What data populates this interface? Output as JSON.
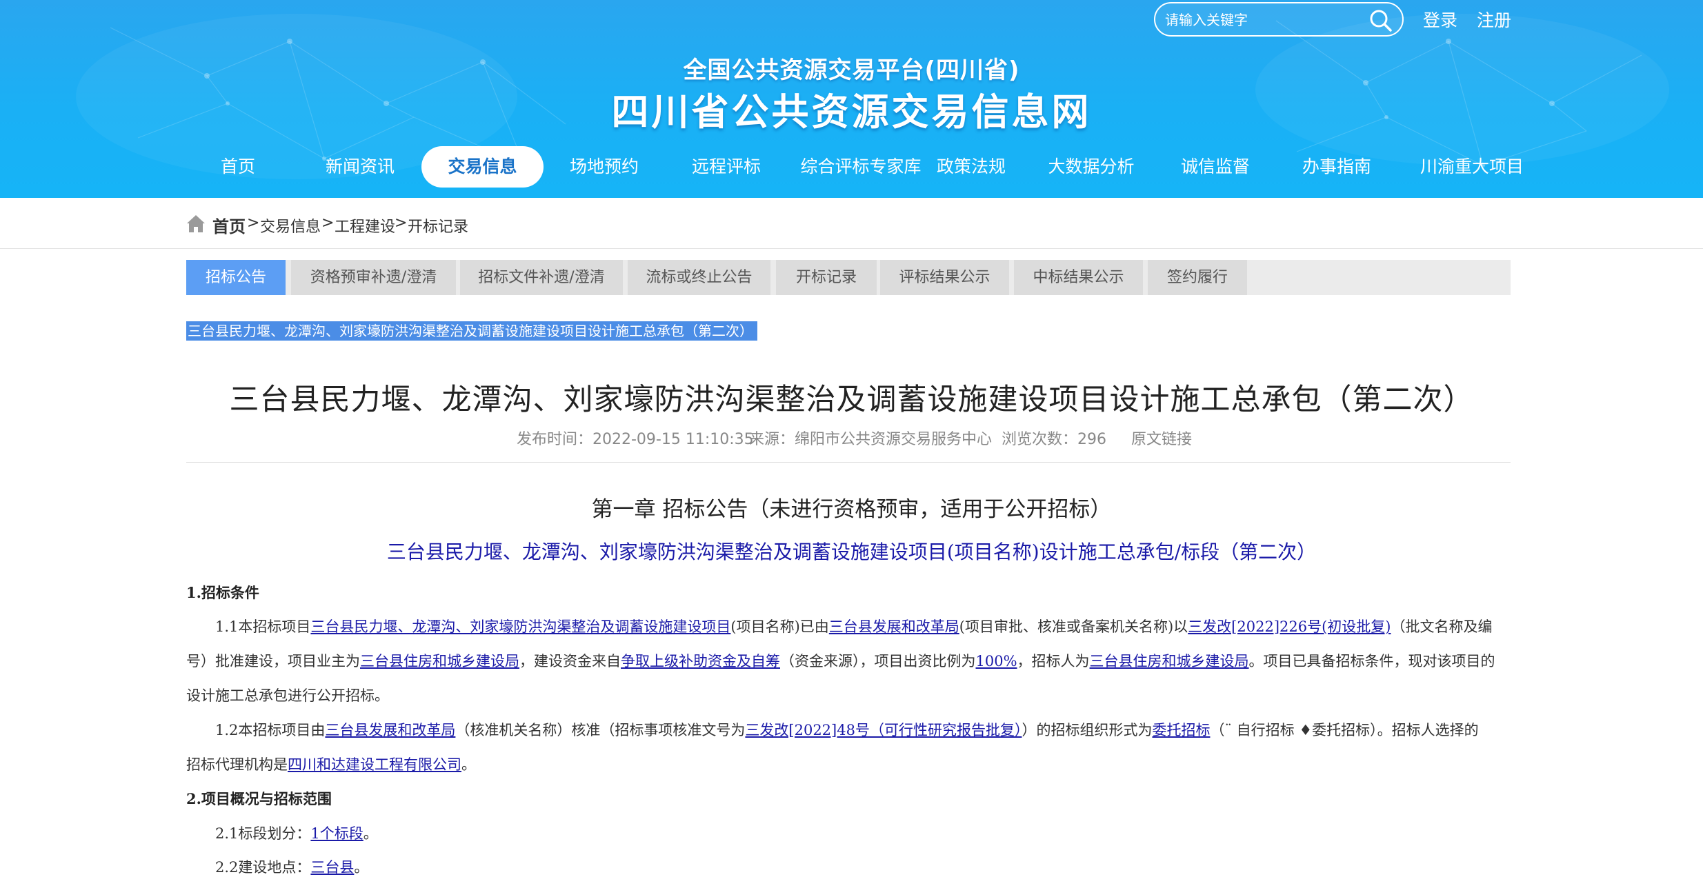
{
  "header": {
    "search_placeholder": "请输入关键字",
    "login": "登录",
    "register": "注册",
    "subtitle": "全国公共资源交易平台(四川省)",
    "title": "四川省公共资源交易信息网"
  },
  "nav": [
    "首页",
    "新闻资讯",
    "交易信息",
    "场地预约",
    "远程评标",
    "综合评标专家库",
    "政策法规",
    "大数据分析",
    "诚信监督",
    "办事指南",
    "川渝重大项目"
  ],
  "breadcrumb": {
    "home": "首页",
    "sep": ">",
    "items": [
      "交易信息",
      "工程建设",
      "开标记录"
    ]
  },
  "tabs": [
    "招标公告",
    "资格预审补遗/澄清",
    "招标文件补遗/澄清",
    "流标或终止公告",
    "开标记录",
    "评标结果公示",
    "中标结果公示",
    "签约履行"
  ],
  "selected_title": "三台县民力堰、龙潭沟、刘家壕防洪沟渠整治及调蓄设施建设项目设计施工总承包（第二次）",
  "article": {
    "title": "三台县民力堰、龙潭沟、刘家壕防洪沟渠整治及调蓄设施建设项目设计施工总承包（第二次）",
    "publish_time": "发布时间：2022-09-15 11:10:35",
    "source": "来源：绵阳市公共资源交易服务中心",
    "views": "浏览次数：296",
    "original_link": "原文链接",
    "chapter": "第一章  招标公告（未进行资格预审，适用于公开招标）",
    "project_name": "三台县民力堰、龙潭沟、刘家壕防洪沟渠整治及调蓄设施建设项目(项目名称)设计施工总承包/标段（第二次）"
  },
  "body": {
    "s1": "1.招标条件",
    "p11_a": "1.1本招标项目",
    "p11_l1": "三台县民力堰、龙潭沟、刘家壕防洪沟渠整治及调蓄设施建设项目",
    "p11_b": "(项目名称)已由",
    "p11_l2": "三台县发展和改革局",
    "p11_c": "(项目审批、核准或备案机关名称)以",
    "p11_l3": "三发改[2022]226号(初设批复)",
    "p11_d": "（批文名称及编",
    "p11_e": "号）批准建设，项目业主为",
    "p11_l4": "三台县住房和城乡建设局",
    "p11_f": "，建设资金来自",
    "p11_l5": "争取上级补助资金及自筹",
    "p11_g": "（资金来源），项目出资比例为",
    "p11_l6": "100%",
    "p11_h": "，招标人为",
    "p11_l7": "三台县住房和城乡建设局",
    "p11_i": "。项目已具备招标条件，现对该项目的",
    "p11_j": "设计施工总承包进行公开招标。",
    "p12_a": "1.2本招标项目由",
    "p12_l1": "三台县发展和改革局",
    "p12_b": "（核准机关名称）核准（招标事项核准文号为",
    "p12_l2": "三发改[2022]48号（可行性研究报告批复）",
    "p12_c": "）的招标组织形式为",
    "p12_l3": "委托招标",
    "p12_d": "（¨ 自行招标  ♦委托招标）。招标人选择的",
    "p12_e": "招标代理机构是",
    "p12_l4": "四川和达建设工程有限公司",
    "p12_f": "。",
    "s2": "2.项目概况与招标范围",
    "p21_a": "2.1标段划分：",
    "p21_l": "1个标段",
    "p21_b": "。",
    "p22_a": "2.2建设地点：",
    "p22_l": "三台县",
    "p22_b": "。"
  }
}
